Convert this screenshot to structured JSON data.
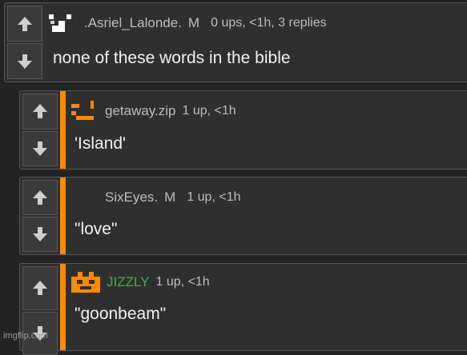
{
  "comments": [
    {
      "username": ".Asriel_Lalonde.",
      "mod_badge": "M",
      "meta": "0 ups, <1h, 3 replies",
      "text": "none of these words in the bible",
      "avatar_icon": "pixel-avatar-white"
    },
    {
      "username": "getaway.zip",
      "meta": "1 up, <1h",
      "text": "'Island'",
      "avatar_icon": "pixel-avatar-orange"
    },
    {
      "username": "SixEyes.",
      "mod_badge": "M",
      "meta": "1 up, <1h",
      "text": "\"love\"",
      "avatar_icon": "no-avatar"
    },
    {
      "username": "JIZZLY",
      "meta": "1 up, <1h",
      "text": "\"goonbeam\"",
      "avatar_icon": "pixel-avatar-orange-face"
    }
  ],
  "watermark": "imgflip.com",
  "colors": {
    "reply_bar": "#ff8a00",
    "username_green": "#3fb33f",
    "panel": "#2f2f2f",
    "background": "#232323"
  }
}
